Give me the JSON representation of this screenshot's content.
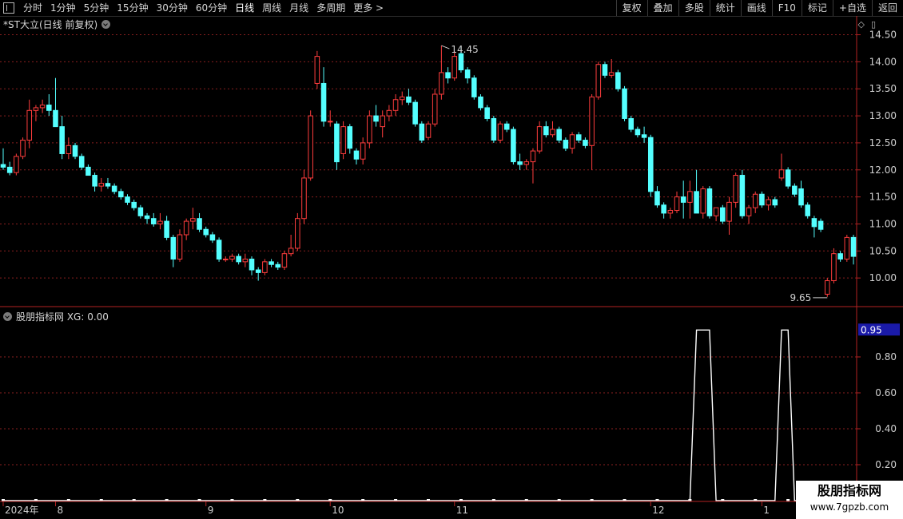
{
  "toolbar": {
    "items": [
      "分时",
      "1分钟",
      "5分钟",
      "15分钟",
      "30分钟",
      "60分钟",
      "日线",
      "周线",
      "月线",
      "多周期",
      "更多 >"
    ],
    "active_index": 6,
    "right_items": [
      "复权",
      "叠加",
      "多股",
      "统计",
      "画线",
      "F10",
      "标记",
      "+自选",
      "返回"
    ]
  },
  "price_panel": {
    "title": "*ST大立(日线 前复权)",
    "high_label": "14.45",
    "low_label": "9.65",
    "y_ticks": [
      "14.50",
      "14.00",
      "13.50",
      "13.00",
      "12.50",
      "12.00",
      "11.50",
      "11.00",
      "10.50",
      "10.00"
    ],
    "icons": [
      "diamond-icon",
      "window-icon"
    ]
  },
  "indicator_panel": {
    "title": "股朋指标网 XG: 0.00",
    "y_ticks": [
      "0.80",
      "0.60",
      "0.40",
      "0.20"
    ],
    "current_value": "0.95"
  },
  "x_axis": {
    "labels": [
      "2024年",
      "8",
      "9",
      "10",
      "11",
      "12",
      "1",
      "202"
    ]
  },
  "watermark": {
    "line1": "股朋指标网",
    "line2": "www.7gpzb.com"
  },
  "colors": {
    "up": "#ff3d3d",
    "down": "#54ffff",
    "grid": "#8a1f1f",
    "axis": "#b22222",
    "xg_line": "#ffffff",
    "value_box": "#1a1aa8"
  },
  "chart_data": {
    "type": "candlestick",
    "ylim": [
      9.5,
      14.7
    ],
    "candles": [
      {
        "o": 12.1,
        "h": 12.4,
        "l": 12.0,
        "c": 12.05
      },
      {
        "o": 12.05,
        "h": 12.15,
        "l": 11.9,
        "c": 11.95
      },
      {
        "o": 11.95,
        "h": 12.3,
        "l": 11.9,
        "c": 12.25
      },
      {
        "o": 12.25,
        "h": 12.6,
        "l": 12.2,
        "c": 12.55
      },
      {
        "o": 12.55,
        "h": 13.3,
        "l": 12.4,
        "c": 13.1
      },
      {
        "o": 13.1,
        "h": 13.2,
        "l": 12.9,
        "c": 13.15
      },
      {
        "o": 13.15,
        "h": 13.3,
        "l": 13.05,
        "c": 13.2
      },
      {
        "o": 13.2,
        "h": 13.4,
        "l": 13.0,
        "c": 13.1
      },
      {
        "o": 13.1,
        "h": 13.7,
        "l": 13.0,
        "c": 12.8
      },
      {
        "o": 12.8,
        "h": 13.0,
        "l": 12.2,
        "c": 12.3
      },
      {
        "o": 12.3,
        "h": 12.6,
        "l": 12.2,
        "c": 12.45
      },
      {
        "o": 12.45,
        "h": 12.5,
        "l": 12.2,
        "c": 12.25
      },
      {
        "o": 12.25,
        "h": 12.3,
        "l": 12.0,
        "c": 12.05
      },
      {
        "o": 12.05,
        "h": 12.1,
        "l": 11.9,
        "c": 11.9
      },
      {
        "o": 11.9,
        "h": 11.95,
        "l": 11.6,
        "c": 11.7
      },
      {
        "o": 11.7,
        "h": 11.85,
        "l": 11.6,
        "c": 11.75
      },
      {
        "o": 11.75,
        "h": 11.85,
        "l": 11.65,
        "c": 11.7
      },
      {
        "o": 11.7,
        "h": 11.75,
        "l": 11.55,
        "c": 11.6
      },
      {
        "o": 11.6,
        "h": 11.65,
        "l": 11.45,
        "c": 11.5
      },
      {
        "o": 11.5,
        "h": 11.55,
        "l": 11.35,
        "c": 11.4
      },
      {
        "o": 11.4,
        "h": 11.45,
        "l": 11.25,
        "c": 11.3
      },
      {
        "o": 11.3,
        "h": 11.35,
        "l": 11.1,
        "c": 11.15
      },
      {
        "o": 11.15,
        "h": 11.2,
        "l": 11.0,
        "c": 11.1
      },
      {
        "o": 11.1,
        "h": 11.2,
        "l": 10.95,
        "c": 11.0
      },
      {
        "o": 11.0,
        "h": 11.2,
        "l": 10.9,
        "c": 11.05
      },
      {
        "o": 11.05,
        "h": 11.15,
        "l": 10.7,
        "c": 10.75
      },
      {
        "o": 10.75,
        "h": 10.8,
        "l": 10.2,
        "c": 10.35
      },
      {
        "o": 10.35,
        "h": 10.9,
        "l": 10.3,
        "c": 10.8
      },
      {
        "o": 10.8,
        "h": 11.1,
        "l": 10.7,
        "c": 11.05
      },
      {
        "o": 11.05,
        "h": 11.3,
        "l": 10.9,
        "c": 11.1
      },
      {
        "o": 11.1,
        "h": 11.2,
        "l": 10.85,
        "c": 10.9
      },
      {
        "o": 10.9,
        "h": 10.95,
        "l": 10.75,
        "c": 10.8
      },
      {
        "o": 10.8,
        "h": 10.85,
        "l": 10.65,
        "c": 10.7
      },
      {
        "o": 10.7,
        "h": 10.75,
        "l": 10.3,
        "c": 10.35
      },
      {
        "o": 10.35,
        "h": 10.4,
        "l": 10.3,
        "c": 10.35
      },
      {
        "o": 10.35,
        "h": 10.45,
        "l": 10.3,
        "c": 10.4
      },
      {
        "o": 10.4,
        "h": 10.45,
        "l": 10.25,
        "c": 10.3
      },
      {
        "o": 10.3,
        "h": 10.45,
        "l": 10.2,
        "c": 10.35
      },
      {
        "o": 10.35,
        "h": 10.4,
        "l": 10.05,
        "c": 10.15
      },
      {
        "o": 10.15,
        "h": 10.2,
        "l": 9.95,
        "c": 10.1
      },
      {
        "o": 10.1,
        "h": 10.35,
        "l": 10.05,
        "c": 10.3
      },
      {
        "o": 10.3,
        "h": 10.35,
        "l": 10.2,
        "c": 10.25
      },
      {
        "o": 10.25,
        "h": 10.3,
        "l": 10.15,
        "c": 10.2
      },
      {
        "o": 10.2,
        "h": 10.5,
        "l": 10.15,
        "c": 10.45
      },
      {
        "o": 10.45,
        "h": 10.8,
        "l": 10.4,
        "c": 10.55
      },
      {
        "o": 10.55,
        "h": 11.2,
        "l": 10.5,
        "c": 11.1
      },
      {
        "o": 11.1,
        "h": 12.0,
        "l": 11.0,
        "c": 11.85
      },
      {
        "o": 11.85,
        "h": 13.1,
        "l": 11.8,
        "c": 13.0
      },
      {
        "o": 13.6,
        "h": 14.2,
        "l": 13.5,
        "c": 14.1
      },
      {
        "o": 13.6,
        "h": 13.9,
        "l": 12.8,
        "c": 12.9
      },
      {
        "o": 12.9,
        "h": 13.1,
        "l": 12.8,
        "c": 12.9
      },
      {
        "o": 12.85,
        "h": 12.9,
        "l": 12.0,
        "c": 12.15
      },
      {
        "o": 12.3,
        "h": 12.9,
        "l": 12.2,
        "c": 12.8
      },
      {
        "o": 12.8,
        "h": 12.85,
        "l": 12.3,
        "c": 12.4
      },
      {
        "o": 12.35,
        "h": 12.4,
        "l": 12.1,
        "c": 12.2
      },
      {
        "o": 12.2,
        "h": 12.6,
        "l": 12.1,
        "c": 12.5
      },
      {
        "o": 12.5,
        "h": 13.1,
        "l": 12.4,
        "c": 13.0
      },
      {
        "o": 13.0,
        "h": 13.2,
        "l": 12.8,
        "c": 12.9
      },
      {
        "o": 12.8,
        "h": 13.1,
        "l": 12.6,
        "c": 13.0
      },
      {
        "o": 13.0,
        "h": 13.2,
        "l": 12.9,
        "c": 13.1
      },
      {
        "o": 13.1,
        "h": 13.4,
        "l": 13.0,
        "c": 13.3
      },
      {
        "o": 13.3,
        "h": 13.45,
        "l": 13.2,
        "c": 13.35
      },
      {
        "o": 13.35,
        "h": 13.5,
        "l": 13.2,
        "c": 13.25
      },
      {
        "o": 13.25,
        "h": 13.3,
        "l": 12.8,
        "c": 12.85
      },
      {
        "o": 12.85,
        "h": 12.9,
        "l": 12.5,
        "c": 12.55
      },
      {
        "o": 12.6,
        "h": 12.9,
        "l": 12.55,
        "c": 12.85
      },
      {
        "o": 12.85,
        "h": 13.5,
        "l": 12.8,
        "c": 13.4
      },
      {
        "o": 13.4,
        "h": 14.3,
        "l": 13.3,
        "c": 13.8
      },
      {
        "o": 13.8,
        "h": 13.9,
        "l": 13.6,
        "c": 13.7
      },
      {
        "o": 13.7,
        "h": 14.2,
        "l": 13.65,
        "c": 14.1
      },
      {
        "o": 14.15,
        "h": 14.3,
        "l": 13.8,
        "c": 13.85
      },
      {
        "o": 13.85,
        "h": 13.9,
        "l": 13.6,
        "c": 13.7
      },
      {
        "o": 13.7,
        "h": 13.75,
        "l": 13.3,
        "c": 13.35
      },
      {
        "o": 13.35,
        "h": 13.4,
        "l": 13.1,
        "c": 13.15
      },
      {
        "o": 13.15,
        "h": 13.2,
        "l": 12.9,
        "c": 12.95
      },
      {
        "o": 12.95,
        "h": 13.0,
        "l": 12.5,
        "c": 12.55
      },
      {
        "o": 12.55,
        "h": 12.9,
        "l": 12.5,
        "c": 12.85
      },
      {
        "o": 12.85,
        "h": 12.9,
        "l": 12.7,
        "c": 12.75
      },
      {
        "o": 12.75,
        "h": 12.8,
        "l": 12.1,
        "c": 12.15
      },
      {
        "o": 12.15,
        "h": 12.3,
        "l": 12.0,
        "c": 12.1
      },
      {
        "o": 12.1,
        "h": 12.2,
        "l": 12.0,
        "c": 12.15
      },
      {
        "o": 12.15,
        "h": 12.4,
        "l": 11.75,
        "c": 12.35
      },
      {
        "o": 12.35,
        "h": 12.9,
        "l": 12.3,
        "c": 12.8
      },
      {
        "o": 12.8,
        "h": 12.9,
        "l": 12.6,
        "c": 12.65
      },
      {
        "o": 12.65,
        "h": 12.9,
        "l": 12.6,
        "c": 12.75
      },
      {
        "o": 12.75,
        "h": 12.8,
        "l": 12.5,
        "c": 12.55
      },
      {
        "o": 12.55,
        "h": 12.6,
        "l": 12.35,
        "c": 12.4
      },
      {
        "o": 12.4,
        "h": 12.7,
        "l": 12.3,
        "c": 12.65
      },
      {
        "o": 12.65,
        "h": 12.7,
        "l": 12.5,
        "c": 12.55
      },
      {
        "o": 12.55,
        "h": 12.6,
        "l": 12.4,
        "c": 12.45
      },
      {
        "o": 12.45,
        "h": 13.4,
        "l": 12.0,
        "c": 13.35
      },
      {
        "o": 13.35,
        "h": 14.0,
        "l": 13.3,
        "c": 13.95
      },
      {
        "o": 13.95,
        "h": 14.0,
        "l": 13.7,
        "c": 13.75
      },
      {
        "o": 13.75,
        "h": 14.05,
        "l": 13.7,
        "c": 13.8
      },
      {
        "o": 13.8,
        "h": 13.85,
        "l": 13.45,
        "c": 13.5
      },
      {
        "o": 13.5,
        "h": 13.55,
        "l": 12.9,
        "c": 12.95
      },
      {
        "o": 12.95,
        "h": 13.0,
        "l": 12.7,
        "c": 12.75
      },
      {
        "o": 12.75,
        "h": 12.8,
        "l": 12.6,
        "c": 12.65
      },
      {
        "o": 12.65,
        "h": 12.8,
        "l": 12.5,
        "c": 12.6
      },
      {
        "o": 12.6,
        "h": 12.65,
        "l": 11.5,
        "c": 11.6
      },
      {
        "o": 11.6,
        "h": 11.7,
        "l": 11.3,
        "c": 11.35
      },
      {
        "o": 11.35,
        "h": 11.4,
        "l": 11.1,
        "c": 11.2
      },
      {
        "o": 11.2,
        "h": 11.3,
        "l": 11.1,
        "c": 11.25
      },
      {
        "o": 11.25,
        "h": 11.6,
        "l": 11.2,
        "c": 11.5
      },
      {
        "o": 11.5,
        "h": 11.8,
        "l": 11.1,
        "c": 11.4
      },
      {
        "o": 11.4,
        "h": 11.8,
        "l": 11.1,
        "c": 11.6
      },
      {
        "o": 11.6,
        "h": 12.0,
        "l": 11.2,
        "c": 11.2
      },
      {
        "o": 11.2,
        "h": 11.7,
        "l": 11.1,
        "c": 11.65
      },
      {
        "o": 11.65,
        "h": 11.7,
        "l": 11.1,
        "c": 11.15
      },
      {
        "o": 11.15,
        "h": 11.3,
        "l": 11.05,
        "c": 11.3
      },
      {
        "o": 11.3,
        "h": 11.35,
        "l": 11.0,
        "c": 11.05
      },
      {
        "o": 11.05,
        "h": 11.5,
        "l": 10.8,
        "c": 11.4
      },
      {
        "o": 11.4,
        "h": 11.95,
        "l": 11.3,
        "c": 11.9
      },
      {
        "o": 11.9,
        "h": 12.0,
        "l": 11.1,
        "c": 11.15
      },
      {
        "o": 11.15,
        "h": 11.35,
        "l": 11.0,
        "c": 11.3
      },
      {
        "o": 11.3,
        "h": 11.6,
        "l": 11.2,
        "c": 11.55
      },
      {
        "o": 11.55,
        "h": 11.6,
        "l": 11.3,
        "c": 11.35
      },
      {
        "o": 11.35,
        "h": 11.5,
        "l": 11.25,
        "c": 11.45
      },
      {
        "o": 11.45,
        "h": 11.5,
        "l": 11.3,
        "c": 11.35
      },
      {
        "o": 11.85,
        "h": 12.3,
        "l": 11.8,
        "c": 12.0
      },
      {
        "o": 12.0,
        "h": 12.05,
        "l": 11.65,
        "c": 11.7
      },
      {
        "o": 11.7,
        "h": 11.75,
        "l": 11.5,
        "c": 11.55
      },
      {
        "o": 11.65,
        "h": 11.8,
        "l": 11.3,
        "c": 11.35
      },
      {
        "o": 11.35,
        "h": 11.4,
        "l": 11.1,
        "c": 11.15
      },
      {
        "o": 11.1,
        "h": 11.15,
        "l": 10.75,
        "c": 10.95
      },
      {
        "o": 11.05,
        "h": 11.1,
        "l": 10.85,
        "c": 10.9
      },
      {
        "o": 9.7,
        "h": 10.0,
        "l": 9.65,
        "c": 9.95
      },
      {
        "o": 9.95,
        "h": 10.55,
        "l": 9.9,
        "c": 10.45
      },
      {
        "o": 10.45,
        "h": 10.5,
        "l": 10.3,
        "c": 10.35
      },
      {
        "o": 10.35,
        "h": 10.8,
        "l": 10.3,
        "c": 10.75
      },
      {
        "o": 10.75,
        "h": 10.8,
        "l": 10.25,
        "c": 10.4
      }
    ],
    "xg_signal": {
      "ylim": [
        0,
        1.0
      ],
      "levels": [
        0,
        0,
        0,
        0,
        0,
        0,
        0,
        0,
        0,
        0,
        0,
        0,
        0,
        0,
        0,
        0,
        0,
        0,
        0,
        0,
        0,
        0,
        0,
        0,
        0,
        0,
        0,
        0,
        0,
        0,
        0,
        0,
        0,
        0,
        0,
        0,
        0,
        0,
        0,
        0,
        0,
        0,
        0,
        0,
        0,
        0,
        0,
        0,
        0,
        0,
        0,
        0,
        0,
        0,
        0,
        0,
        0,
        0,
        0,
        0,
        0,
        0,
        0,
        0,
        0,
        0,
        0,
        0,
        0,
        0,
        0,
        0,
        0,
        0,
        0,
        0,
        0,
        0,
        0,
        0,
        0,
        0,
        0,
        0,
        0,
        0,
        0,
        0,
        0,
        0,
        0,
        0,
        0,
        0,
        0,
        0,
        0,
        0,
        0,
        0,
        0,
        0,
        0,
        0,
        0,
        0,
        1,
        1,
        1,
        0,
        0,
        0,
        0,
        0,
        0,
        0,
        0,
        0,
        0,
        1,
        1,
        0,
        0,
        0,
        0,
        0,
        0,
        0,
        0
      ]
    }
  }
}
